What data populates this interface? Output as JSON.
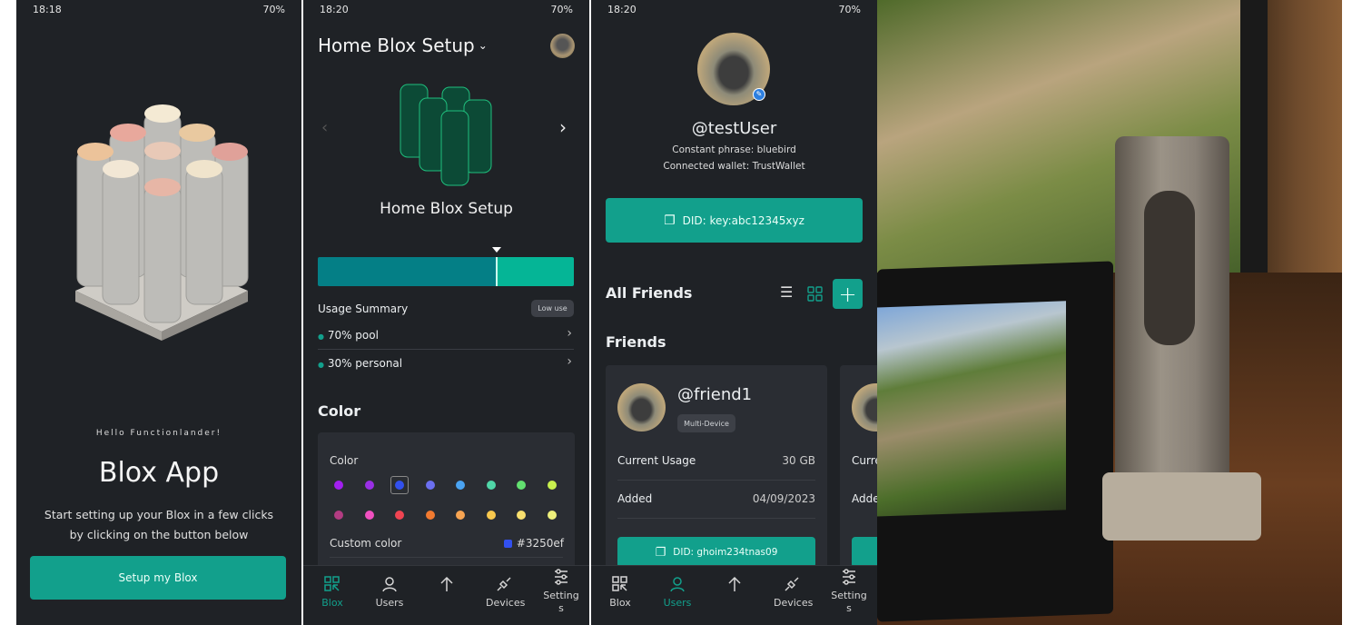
{
  "screen1": {
    "status_time": "18:18",
    "status_battery": "70%",
    "greeting": "Hello Functionlander!",
    "title": "Blox App",
    "description": "Start setting up your Blox in a few clicks by clicking on the button below",
    "setup_button": "Setup my Blox"
  },
  "screen2": {
    "status_time": "18:20",
    "status_battery": "70%",
    "header_title": "Home Blox Setup",
    "device_name": "Home Blox Setup",
    "usage": {
      "pool_percent": 70,
      "personal_percent": 30,
      "pool_color": "#047f86",
      "personal_color": "#05b596"
    },
    "usage_summary_label": "Usage Summary",
    "usage_badge": "Low use",
    "rows": [
      "70% pool",
      "30% personal"
    ],
    "color_section_title": "Color",
    "color_label": "Color",
    "swatches_row1": [
      "#a21ff0",
      "#9a2fe6",
      "#3250ef",
      "#6b6ff0",
      "#4aa3f2",
      "#50d6a8",
      "#62e070",
      "#c8f04e"
    ],
    "swatches_row2": [
      "#b23c82",
      "#f050c0",
      "#f04452",
      "#f27a30",
      "#f7a452",
      "#f8c84e",
      "#f8df6e",
      "#eef07c"
    ],
    "selected_swatch": "#3250ef",
    "custom_color_label": "Custom color",
    "custom_color_value": "#3250ef"
  },
  "screen3": {
    "status_time": "18:20",
    "status_battery": "70%",
    "username": "@testUser",
    "constant_phrase": "Constant phrase: bluebird",
    "connected_wallet": "Connected wallet: TrustWallet",
    "did_button": "DID: key:abc12345xyz",
    "all_friends_title": "All Friends",
    "friends_title": "Friends",
    "friend": {
      "name": "@friend1",
      "badge": "Multi-Device",
      "usage_label": "Current Usage",
      "usage_value": "30 GB",
      "added_label": "Added",
      "added_value": "04/09/2023",
      "did_button": "DID: ghoim234tnas09"
    },
    "friend_partial": {
      "usage_label": "Curre",
      "added_label": "Adde"
    }
  },
  "nav": {
    "blox": "Blox",
    "users": "Users",
    "devices": "Devices",
    "settings": "Setting s"
  },
  "accent": "#12a08c"
}
